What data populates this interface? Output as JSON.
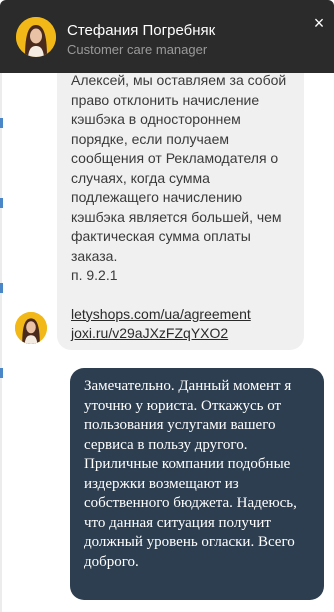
{
  "header": {
    "agent_name": "Стефания Погребняк",
    "agent_role": "Customer care manager",
    "close_symbol": "×"
  },
  "messages": {
    "incoming": {
      "text": "Алексей, мы оставляем за собой право отклонить начисление кэшбэка в одностороннем порядке, если получаем сообщения от Рекламодателя о случаях, когда сумма подлежащего начислению кэшбэка является большей, чем фактическая сумма оплаты заказа.",
      "clause": "п. 9.2.1",
      "link_1": "letyshops.com/ua/agreement",
      "link_2": "joxi.ru/v29aJXzFZqYXO2"
    },
    "outgoing": {
      "text": "Замечательно. Данный момент я уточню у юриста. Откажусь от пользования услугами вашего сервиса в пользу другого. Приличные компании подобные издержки возмещают из собственного бюджета. Надеюсь, что данная ситуация получит должный уровень огласки. Всего доброго."
    }
  },
  "icons": {
    "avatar": "agent-avatar-icon",
    "close": "close-icon"
  },
  "colors": {
    "header_bg": "#2b2b2b",
    "incoming_bubble": "#f0f0f0",
    "outgoing_bubble": "#2d3e50",
    "avatar_bg": "#f2b818"
  }
}
